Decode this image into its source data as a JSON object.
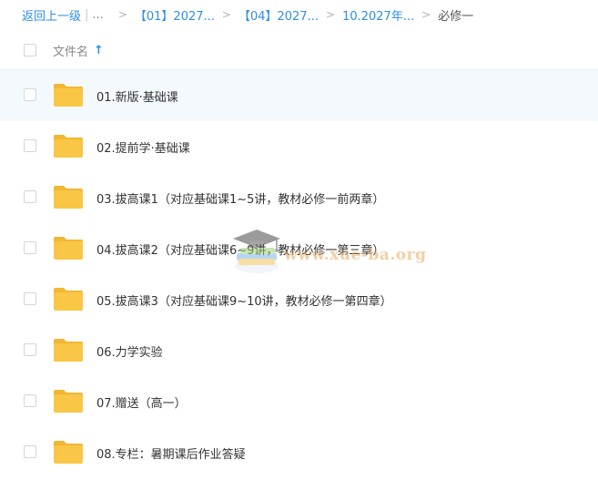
{
  "breadcrumb": {
    "back_label": "返回上一级",
    "separator": "|",
    "ellipsis": "...",
    "arrow": ">",
    "items": [
      {
        "label": "【01】2027..."
      },
      {
        "label": "【04】2027..."
      },
      {
        "label": "10.2027年..."
      }
    ],
    "current": "必修一"
  },
  "header": {
    "column_label": "文件名",
    "sort_icon": "arrow-up-icon",
    "sort_glyph": "↑"
  },
  "files": [
    {
      "name": "01.新版·基础课",
      "icon": "folder-icon"
    },
    {
      "name": "02.提前学·基础课",
      "icon": "folder-icon"
    },
    {
      "name": "03.拔高课1（对应基础课1~5讲，教材必修一前两章）",
      "icon": "folder-icon"
    },
    {
      "name": "04.拔高课2（对应基础课6~9讲，教材必修一第三章）",
      "icon": "folder-icon"
    },
    {
      "name": "05.拔高课3（对应基础课9~10讲，教材必修一第四章）",
      "icon": "folder-icon"
    },
    {
      "name": "06.力学实验",
      "icon": "folder-icon"
    },
    {
      "name": "07.赠送（高一）",
      "icon": "folder-icon"
    },
    {
      "name": "08.专栏：暑期课后作业答疑",
      "icon": "folder-icon"
    }
  ],
  "watermark": {
    "text": "www.xue-ba.org",
    "icon": "graduation-cap-books-icon"
  },
  "colors": {
    "link": "#2c8ee8",
    "folder": "#f9c646",
    "folder_tab": "#f2b632",
    "selected_row": "#f4f9fe"
  }
}
